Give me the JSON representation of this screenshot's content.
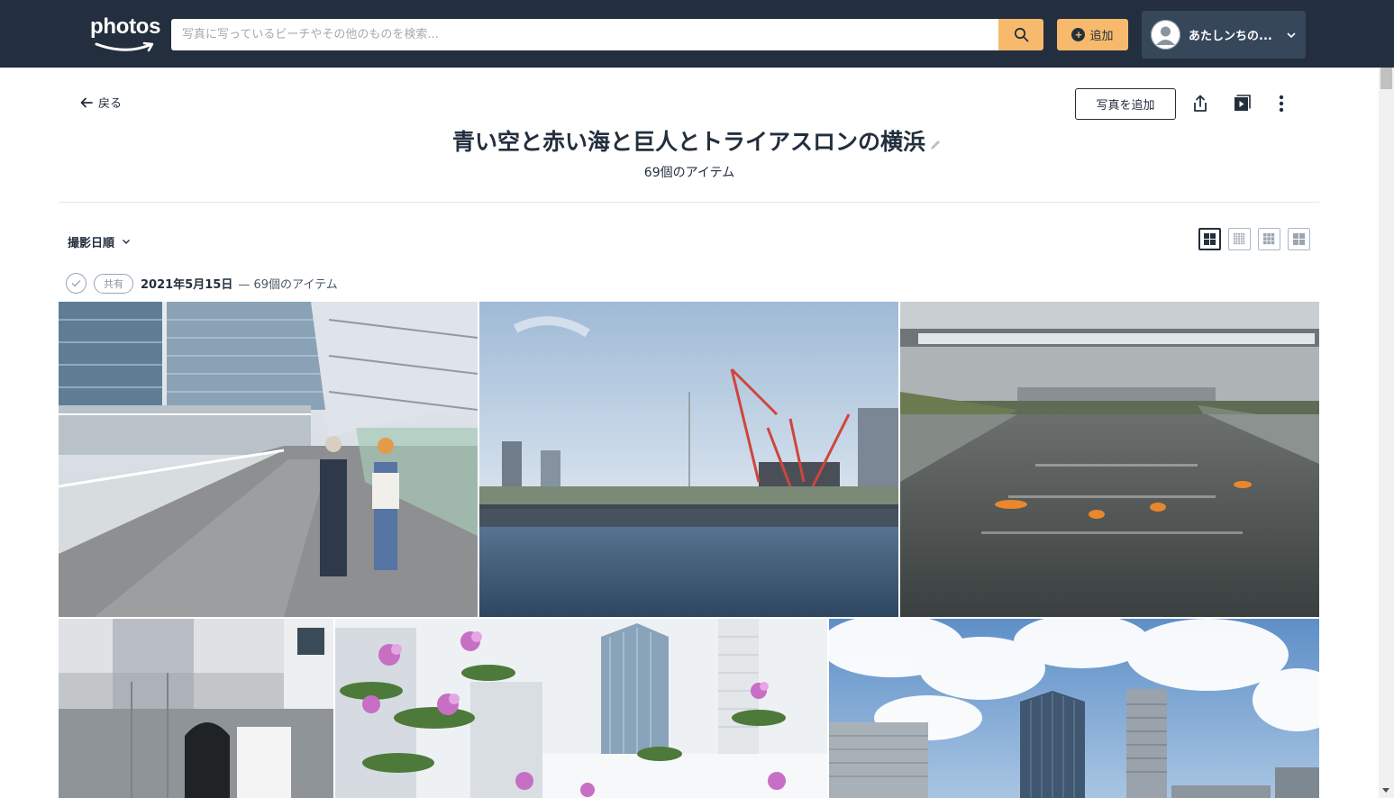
{
  "header": {
    "logo_text": "photos",
    "search_placeholder": "写真に写っているビーチやその他のものを検索...",
    "add_label": "追加",
    "account_name": "あたしンちの...",
    "colors": {
      "bar": "#232f3e",
      "accent": "#f7ba6d"
    }
  },
  "album": {
    "back_label": "戻る",
    "add_photos_label": "写真を追加",
    "title": "青い空と赤い海と巨人とトライアスロンの横浜",
    "item_count": "69個のアイテム",
    "actions": [
      "share-icon",
      "slideshow-icon",
      "more-options-icon"
    ]
  },
  "controls": {
    "sort_label": "撮影日順",
    "view_modes": [
      "view-large-grid-icon",
      "view-small-grid-icon",
      "view-medium-grid-icon",
      "view-square-grid-icon"
    ]
  },
  "group": {
    "share_label": "共有",
    "date": "2021年5月15日",
    "count": "— 69個のアイテム"
  },
  "photos": [
    {
      "name": "photo-skywalk-couple",
      "subject": "elevated walkway with couple walking"
    },
    {
      "name": "photo-river-cranes",
      "subject": "river with bridge and construction cranes"
    },
    {
      "name": "photo-canal-kayaks",
      "subject": "canal with kayakers"
    },
    {
      "name": "photo-window-reflection",
      "subject": "building interior reflection"
    },
    {
      "name": "photo-flowers-towers",
      "subject": "pink flowers in front of towers"
    },
    {
      "name": "photo-towers-sky",
      "subject": "towers under cloudy sky"
    }
  ]
}
